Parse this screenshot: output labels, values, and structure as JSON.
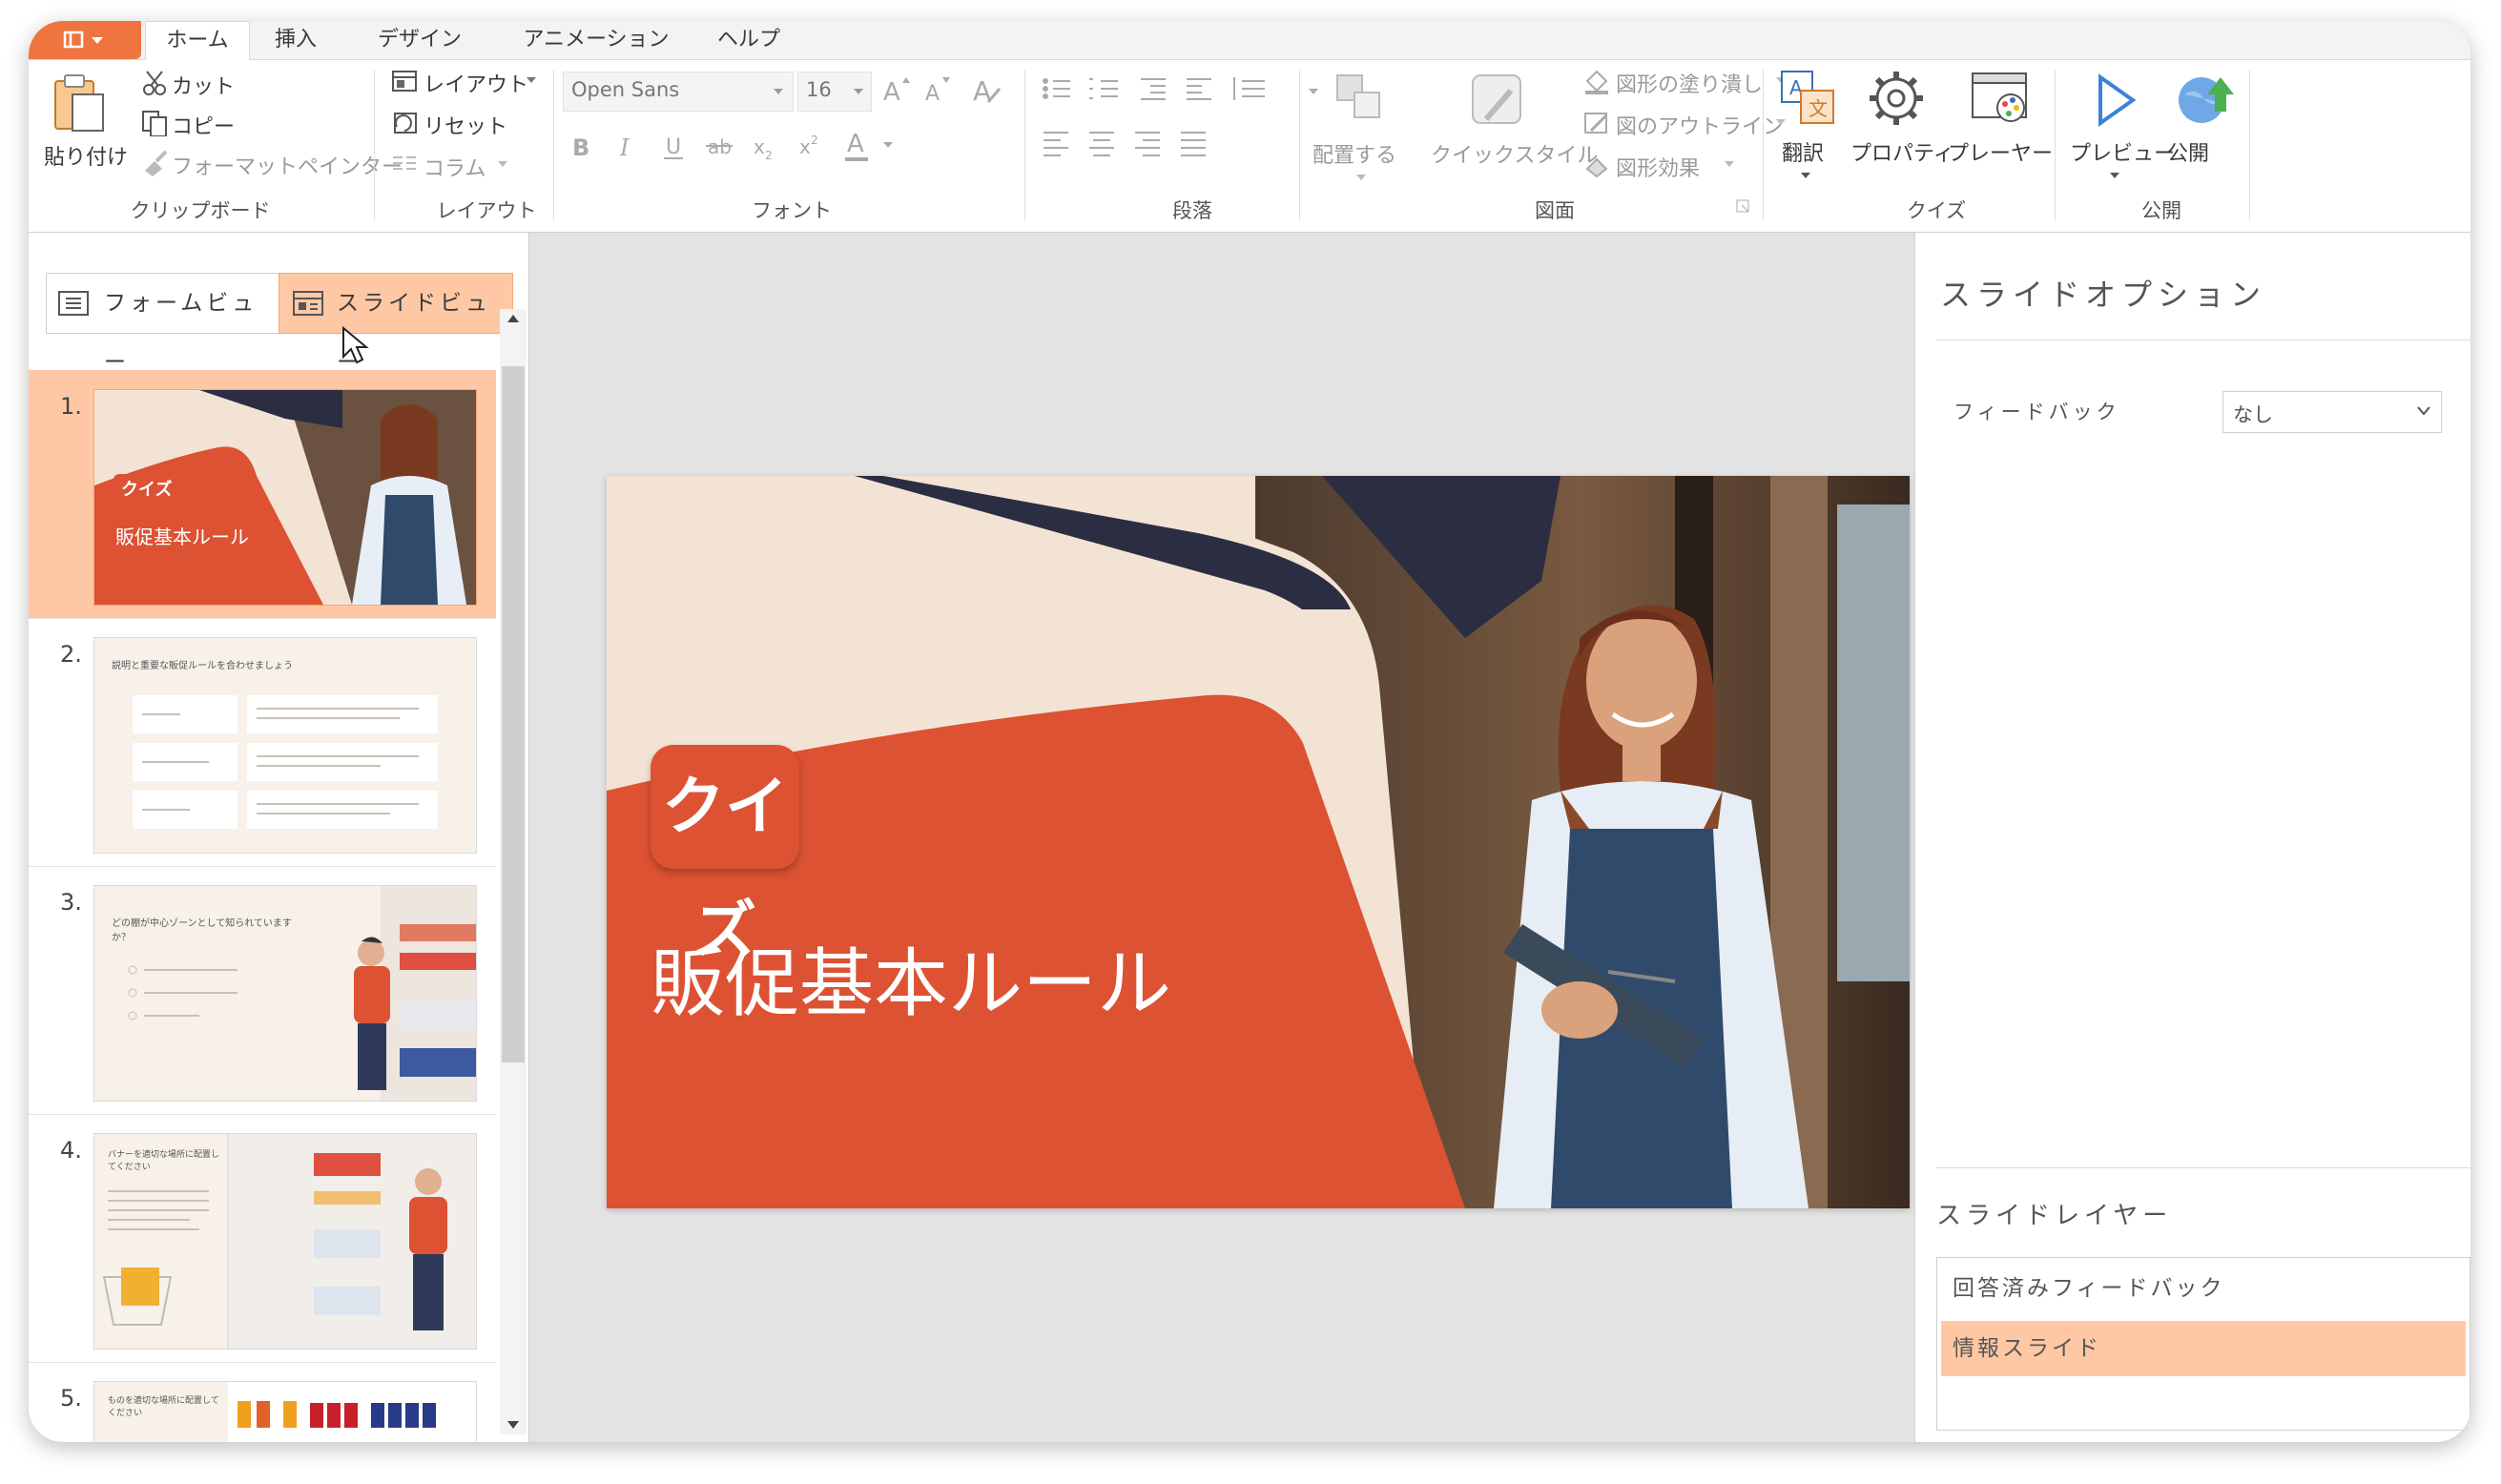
{
  "tabs": [
    "ホーム",
    "挿入",
    "デザイン",
    "アニメーション",
    "ヘルプ"
  ],
  "ribbon": {
    "clipboard": {
      "paste": "貼り付け",
      "cut": "カット",
      "copy": "コピー",
      "format_painter": "フォーマットペインター",
      "label": "クリップボード"
    },
    "layout": {
      "layout": "レイアウト",
      "reset": "リセット",
      "column": "コラム",
      "label": "レイアウト"
    },
    "font": {
      "family": "Open Sans",
      "size": "16",
      "label": "フォント"
    },
    "paragraph": {
      "label": "段落"
    },
    "drawing": {
      "arrange": "配置する",
      "quick_style": "クイックスタイル",
      "shape_fill": "図形の塗り潰し",
      "shape_outline": "図のアウトライン",
      "shape_effects": "図形効果",
      "label": "図面"
    },
    "quiz": {
      "translate": "翻訳",
      "properties": "プロパティ",
      "player": "プレーヤー",
      "label": "クイズ"
    },
    "publish": {
      "preview": "プレビュー",
      "publish": "公開",
      "label": "公開"
    }
  },
  "left": {
    "form_view": "フォームビュー",
    "slide_view": "スライドビュー",
    "thumbnails": [
      {
        "num": "1.",
        "tag": "クイズ",
        "title": "販促基本ルール"
      },
      {
        "num": "2.",
        "title": "説明と重要な販促ルールを合わせましょう"
      },
      {
        "num": "3.",
        "title": "どの棚が中心ゾーンとして知られていますか？"
      },
      {
        "num": "4.",
        "title": "バナーを適切な場所に配置してください"
      },
      {
        "num": "5.",
        "title": "ものを適切な場所に配置してください"
      }
    ]
  },
  "slide": {
    "tag": "クイズ",
    "title": "販促基本ルール"
  },
  "right": {
    "title": "スライドオプション",
    "feedback_label": "フィードバック",
    "feedback_value": "なし",
    "layers_title": "スライドレイヤー",
    "layers": [
      "回答済みフィードバック",
      "情報スライド"
    ]
  },
  "colors": {
    "accent": "#f0743f",
    "slide_red": "#dc5233",
    "cream": "#f3e3d4",
    "navy": "#2b2d42",
    "selection": "#ffc8a5"
  }
}
